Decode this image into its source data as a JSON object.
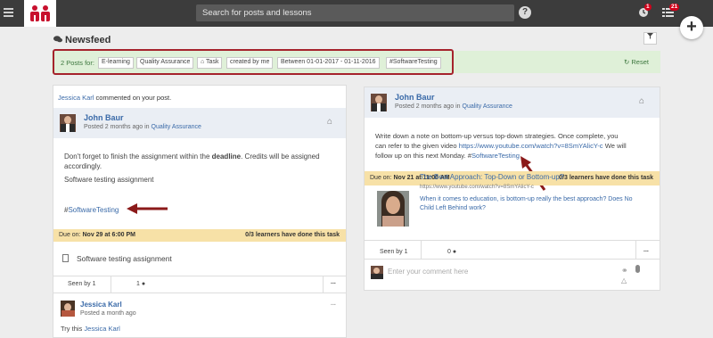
{
  "app": {
    "search_placeholder": "Search for posts and lessons",
    "help_label": "?",
    "notifications_badge": "1",
    "messages_badge": "21",
    "plus_label": "+"
  },
  "newsfeed": {
    "title": "Newsfeed",
    "filter_summary": "2 Posts for:",
    "filters": [
      "E-learning",
      "Quality Assurance",
      "Task",
      "created by me",
      "Between 01-01-2017 - 01-11-2016",
      "#SoftwareTesting"
    ],
    "reset_label": "Reset"
  },
  "left_post": {
    "activity_user": "Jessica Karl",
    "activity_text": "commented on your post.",
    "author": "John Baur",
    "posted_prefix": "Posted 2 months ago in",
    "posted_group": "Quality Assurance",
    "body_line1_pre": "Don't forget to finish the assignment within the",
    "body_bold": "deadline",
    "body_line1_post": ". Credits will be assigned",
    "body_line2": "accordingly.",
    "link": "Software testing assignment",
    "hashtag": "SoftwareTesting",
    "due_label": "Due on:",
    "due_value": "Nov 29 at 6:00 PM",
    "learners_status": "0/3 learners have done this task",
    "attachment": "Software testing assignment",
    "seen_by": "Seen by 1",
    "comment_count": "1",
    "more": "...",
    "comment_author": "Jessica Karl",
    "comment_time": "Posted a month ago",
    "comment_text_pre": "Try this",
    "comment_mention": "Jessica Karl"
  },
  "right_post": {
    "author": "John Baur",
    "posted_prefix": "Posted 2 months ago in",
    "posted_group": "Quality Assurance",
    "body_line1": "Write down a note on bottom-up versus top-down strategies. Once complete, you",
    "body_line2_pre": "can refer to the given video",
    "body_url": "https://www.youtube.com/watch?v=8SmYAlicY-c",
    "body_line2_post": "We will",
    "body_line3_pre": "follow up on this next Monday.",
    "hashtag": "SoftwareTesting",
    "due_label": "Due on:",
    "due_value": "Nov 21 at 11:00 AM",
    "learners_status": "0/3 learners have done this task",
    "preview_title": "The Best Approach: Top-Down or Bottom-up?",
    "preview_url": "https://www.youtube.com/watch?v=8SmYAlicY-c",
    "preview_desc1": "When it comes to education, is bottom-up really the best approach? Does No",
    "preview_desc2": "Child Left Behind work?",
    "seen_by": "Seen by 1",
    "comment_count": "0",
    "more": "...",
    "comment_placeholder": "Enter your comment here"
  },
  "colors": {
    "topbar": "#3c3c3c",
    "accent_red": "#a5232c",
    "link": "#3a6aa8",
    "due_bg": "#f7e1a7",
    "filter_bg": "#dff0d8"
  }
}
